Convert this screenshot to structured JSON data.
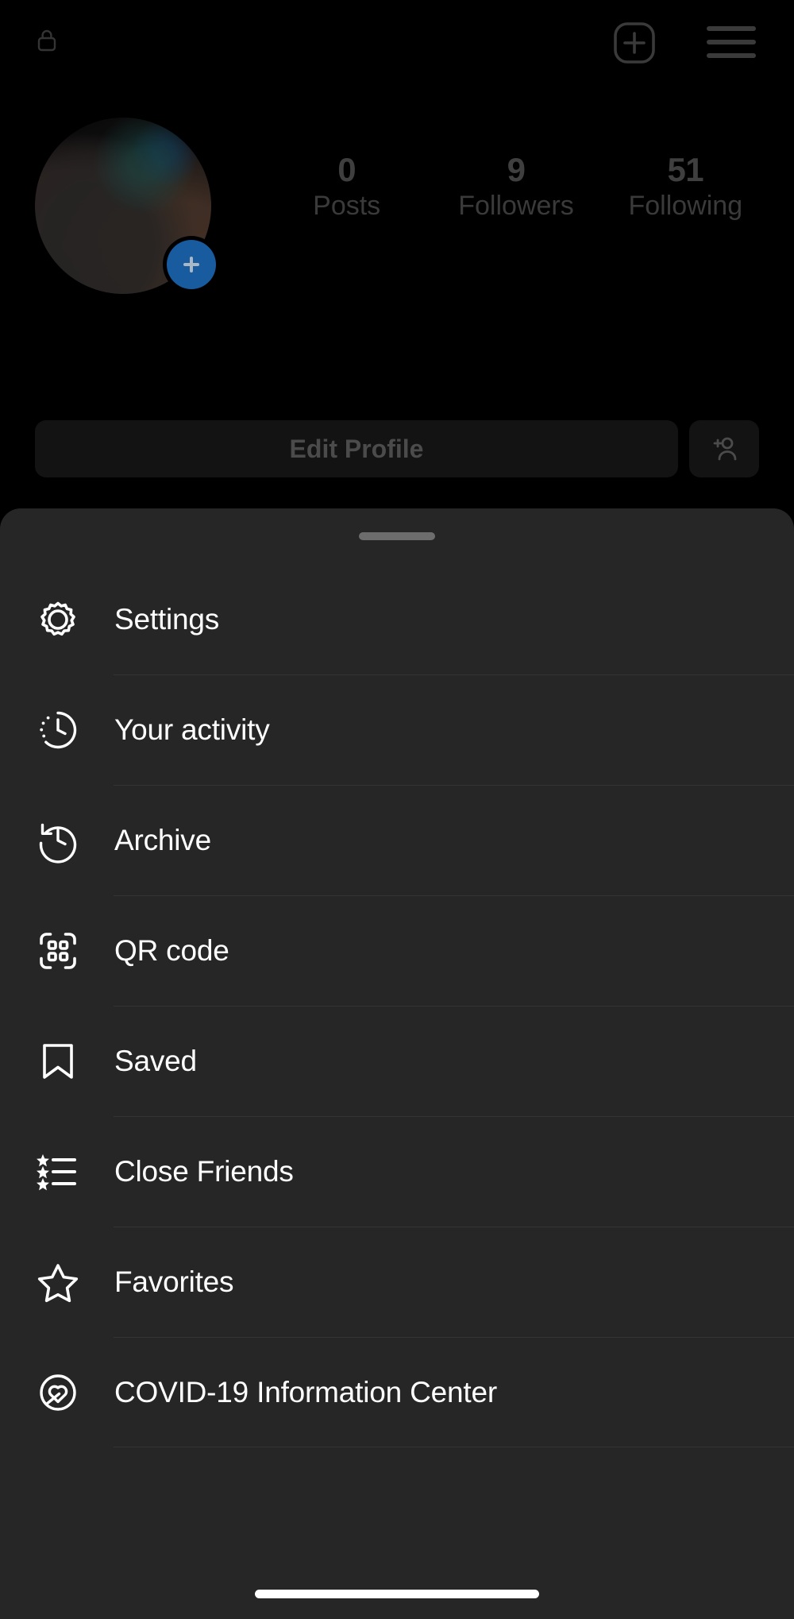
{
  "theme": {
    "background": "#000000",
    "sheet_background": "#262626",
    "divider": "#343434",
    "text_primary": "#ffffff",
    "text_dim": "#3f3f3f",
    "accent_blue": "#1d6fc2",
    "handle": "#6d6d6d"
  },
  "top_bar": {
    "lock_icon": "lock-icon",
    "add_post_icon": "plus-square-icon",
    "menu_icon": "hamburger-menu-icon"
  },
  "profile": {
    "avatar_alt": "profile-photo-dog",
    "avatar_badge_icon": "plus-icon",
    "stats": [
      {
        "value": "0",
        "label": "Posts"
      },
      {
        "value": "9",
        "label": "Followers"
      },
      {
        "value": "51",
        "label": "Following"
      }
    ]
  },
  "actions": {
    "edit_profile_label": "Edit Profile",
    "add_person_icon": "person-add-icon"
  },
  "menu_sheet": {
    "handle": "drag-handle",
    "items": [
      {
        "label": "Settings",
        "icon": "gear-icon"
      },
      {
        "label": "Your activity",
        "icon": "activity-clock-icon"
      },
      {
        "label": "Archive",
        "icon": "archive-history-icon"
      },
      {
        "label": "QR code",
        "icon": "qr-code-icon"
      },
      {
        "label": "Saved",
        "icon": "bookmark-icon"
      },
      {
        "label": "Close Friends",
        "icon": "star-list-icon"
      },
      {
        "label": "Favorites",
        "icon": "star-outline-icon"
      },
      {
        "label": "COVID-19 Information Center",
        "icon": "heart-circle-icon"
      }
    ]
  },
  "system": {
    "home_indicator": "home-indicator"
  }
}
